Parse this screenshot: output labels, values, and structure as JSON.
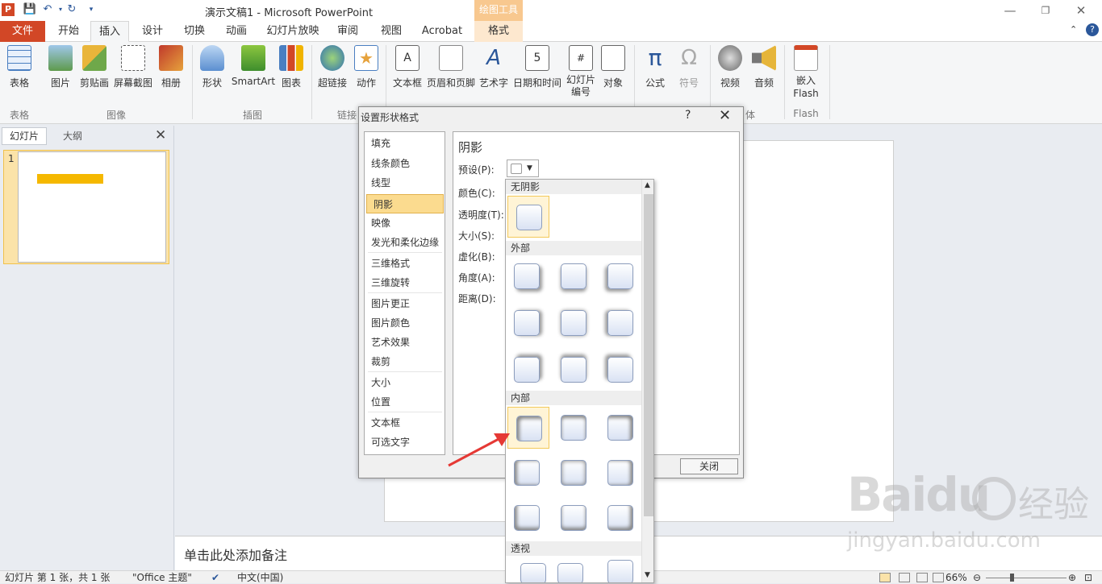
{
  "window": {
    "title": "演示文稿1 - Microsoft PowerPoint",
    "app_icon": "P",
    "context_group": "绘图工具"
  },
  "tabs": [
    "文件",
    "开始",
    "插入",
    "设计",
    "切换",
    "动画",
    "幻灯片放映",
    "审阅",
    "视图",
    "Acrobat",
    "格式"
  ],
  "ribbon": {
    "buttons": [
      "表格",
      "图片",
      "剪贴画",
      "屏幕截图",
      "相册",
      "形状",
      "SmartArt",
      "图表",
      "超链接",
      "动作",
      "文本框",
      "页眉和页脚",
      "艺术字",
      "日期和时间",
      "幻灯片编号",
      "对象",
      "公式",
      "符号",
      "视频",
      "音频",
      "嵌入Flash"
    ],
    "groups": [
      "表格",
      "图像",
      "插图",
      "链接",
      "体",
      "Flash"
    ]
  },
  "panel": {
    "tab_slides": "幻灯片",
    "tab_outline": "大纲",
    "close": "✕",
    "slide_number": "1"
  },
  "notes": {
    "placeholder": "单击此处添加备注"
  },
  "status": {
    "slide_info": "幻灯片 第 1 张，共 1 张",
    "theme": "\"Office 主题\"",
    "language": "中文(中国)",
    "zoom": "66%"
  },
  "dialog": {
    "title": "设置形状格式",
    "help": "?",
    "close_x": "✕",
    "categories": [
      "填充",
      "线条颜色",
      "线型",
      "阴影",
      "映像",
      "发光和柔化边缘",
      "三维格式",
      "三维旋转",
      "图片更正",
      "图片颜色",
      "艺术效果",
      "裁剪",
      "大小",
      "位置",
      "文本框",
      "可选文字"
    ],
    "selected_category": "阴影",
    "section_title": "阴影",
    "fields": [
      "预设(P):",
      "颜色(C):",
      "透明度(T):",
      "大小(S):",
      "虚化(B):",
      "角度(A):",
      "距离(D):"
    ],
    "close_button": "关闭"
  },
  "gallery": {
    "headers": [
      "无阴影",
      "外部",
      "内部",
      "透视"
    ]
  },
  "watermark": {
    "brand": "Baidu",
    "cn": "经验",
    "url": "jingyan.baidu.com"
  }
}
